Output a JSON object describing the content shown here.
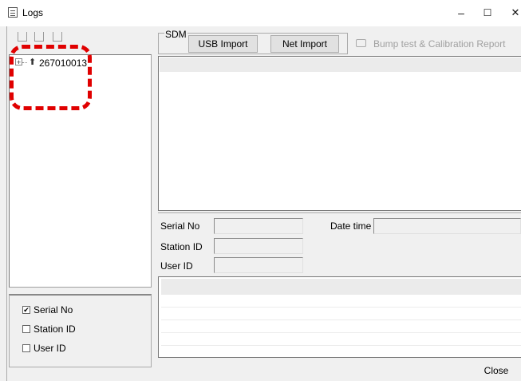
{
  "window": {
    "title": "Logs",
    "minimize": "–",
    "maximize": "☐",
    "close": "✕"
  },
  "tree": {
    "node_label": "267010013"
  },
  "filters": [
    {
      "label": "Serial No",
      "checked": true,
      "mark": "✔"
    },
    {
      "label": "Station ID",
      "checked": false,
      "mark": ""
    },
    {
      "label": "User ID",
      "checked": false,
      "mark": ""
    }
  ],
  "sdm": {
    "group_label": "SDM",
    "usb_import": "USB Import",
    "net_import": "Net Import"
  },
  "report_button": {
    "label": "Bump test & Calibration Report",
    "enabled": false
  },
  "details": {
    "serial_no_label": "Serial No",
    "serial_no_value": "",
    "date_time_label": "Date time",
    "date_time_value": "",
    "station_id_label": "Station ID",
    "station_id_value": "",
    "user_id_label": "User ID",
    "user_id_value": ""
  },
  "footer": {
    "close_label": "Close"
  },
  "colors": {
    "highlight": "#e00000",
    "disabled_text": "#a0a0a0"
  }
}
